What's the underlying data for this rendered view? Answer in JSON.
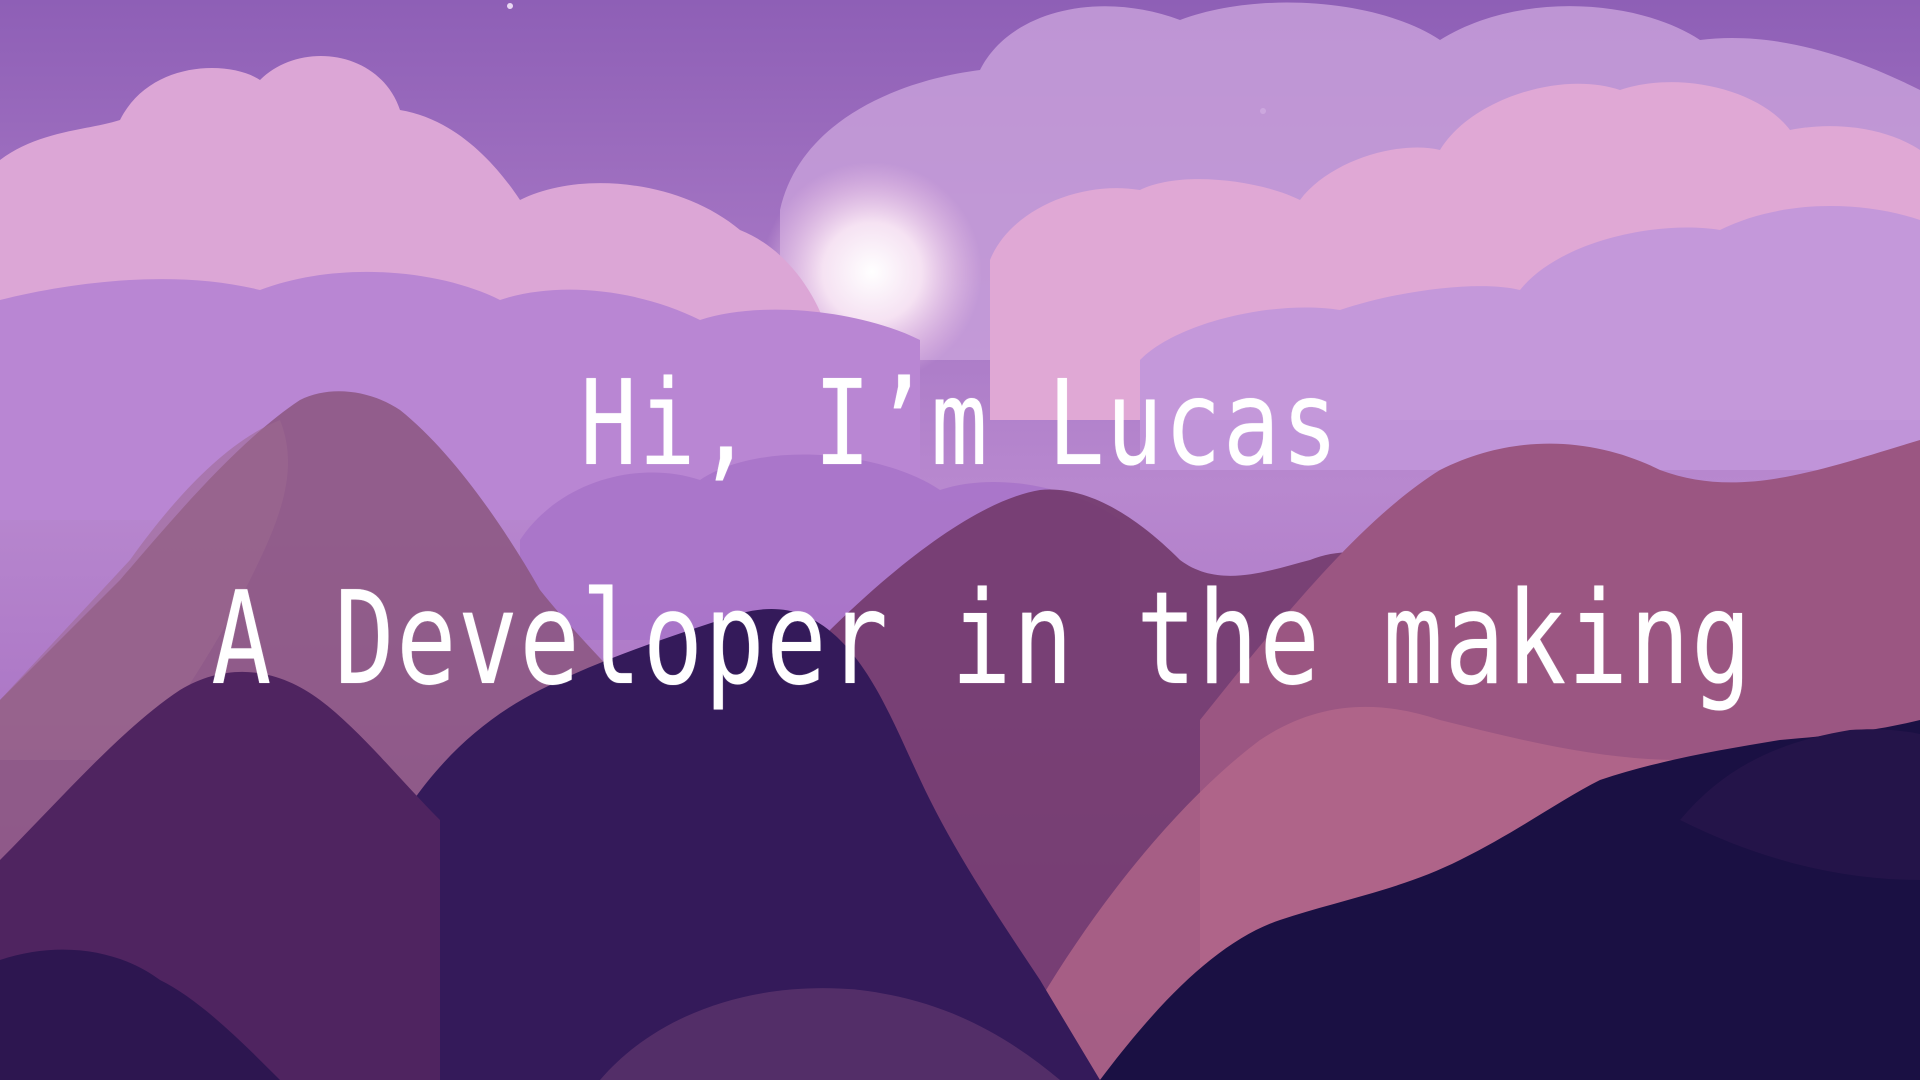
{
  "hero": {
    "greeting": "Hi, I’m Lucas",
    "tagline": "A Developer in the making"
  },
  "colors": {
    "sky_top": "#8e5fb6",
    "sky_mid": "#b888cf",
    "cloud_pink": "#e2a9d6",
    "cloud_lilac": "#c49fdc",
    "moon": "#fbeef8",
    "mountain_mauve": "#8a4f7f",
    "mountain_rose": "#a65f86",
    "mountain_plum": "#5e2e6b",
    "mountain_deep": "#341a5a",
    "mountain_navy": "#1a1043",
    "text": "#ffffff"
  }
}
